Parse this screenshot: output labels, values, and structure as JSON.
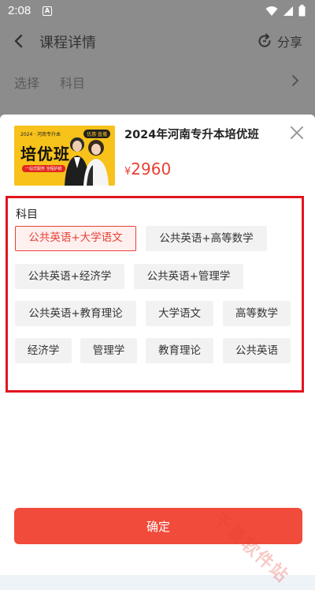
{
  "status_bar": {
    "time": "2:08",
    "notif_letter": "A"
  },
  "nav": {
    "title": "课程详情",
    "share_label": "分享"
  },
  "select_row": {
    "label": "选择",
    "value": "科目"
  },
  "course": {
    "title": "2024年河南专升本培优班",
    "price_symbol": "¥",
    "price": "2960",
    "thumbnail": {
      "top_text": "2024 · 河南专升本",
      "badge": "优惠·直播",
      "title": "培优班",
      "subtitle": "一站式服务 全程护航"
    }
  },
  "subjects": {
    "heading": "科目",
    "selected_index": 0,
    "options": [
      "公共英语+大学语文",
      "公共英语+高等数学",
      "公共英语+经济学",
      "公共英语+管理学",
      "公共英语+教育理论",
      "大学语文",
      "高等数学",
      "经济学",
      "管理学",
      "教育理论",
      "公共英语"
    ]
  },
  "confirm_label": "确定",
  "watermark_text": "千景软件站",
  "colors": {
    "accent": "#f04b3b",
    "price": "#e84135",
    "highlight_frame": "#e3141e",
    "overlay": "#8c8c8c"
  }
}
